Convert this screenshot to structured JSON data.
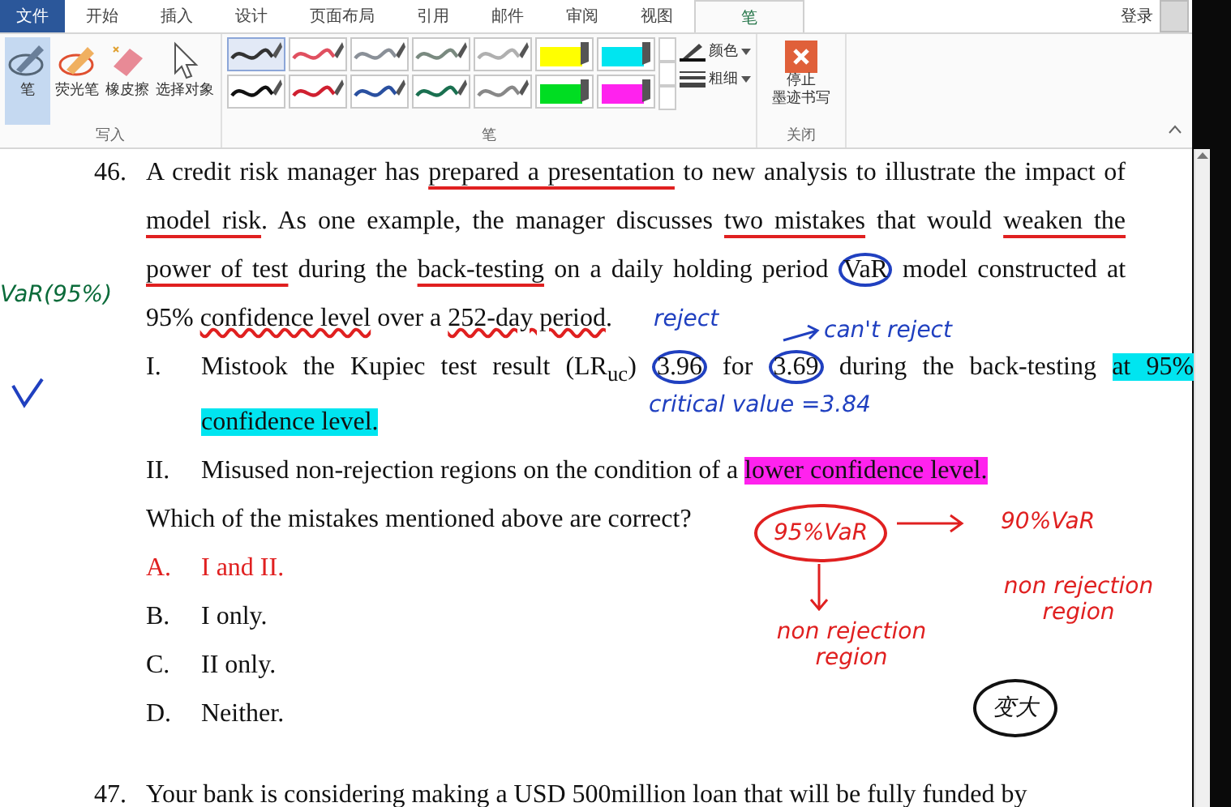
{
  "tabs": [
    {
      "label": "文件",
      "kind": "file",
      "selected": false
    },
    {
      "label": "开始",
      "kind": "tab",
      "selected": false
    },
    {
      "label": "插入",
      "kind": "tab",
      "selected": false
    },
    {
      "label": "设计",
      "kind": "tab",
      "selected": false
    },
    {
      "label": "页面布局",
      "kind": "tab",
      "selected": false
    },
    {
      "label": "引用",
      "kind": "tab",
      "selected": false
    },
    {
      "label": "邮件",
      "kind": "tab",
      "selected": false
    },
    {
      "label": "审阅",
      "kind": "tab",
      "selected": false
    },
    {
      "label": "视图",
      "kind": "tab",
      "selected": false
    },
    {
      "label": "笔",
      "kind": "tab",
      "selected": true
    }
  ],
  "account": {
    "label": "登录"
  },
  "write_group": {
    "label": "写入",
    "tools": [
      {
        "label": "笔",
        "kind": "pen",
        "selected": true
      },
      {
        "label": "荧光笔",
        "kind": "highlighter",
        "selected": false
      },
      {
        "label": "橡皮擦",
        "kind": "eraser",
        "selected": false
      },
      {
        "label": "选择对象",
        "kind": "select",
        "selected": false
      }
    ]
  },
  "pens_group": {
    "label": "笔",
    "pens": [
      {
        "kind": "pen",
        "color": "#333333",
        "selected": true
      },
      {
        "kind": "pen",
        "color": "#e05060",
        "selected": false
      },
      {
        "kind": "pen",
        "color": "#8a9098",
        "selected": false
      },
      {
        "kind": "pen",
        "color": "#7a8a80",
        "selected": false
      },
      {
        "kind": "pen",
        "color": "#b0b0b0",
        "selected": false
      },
      {
        "kind": "highlighter",
        "color": "#ffff00",
        "selected": false
      },
      {
        "kind": "highlighter",
        "color": "#00e5f0",
        "selected": false
      },
      {
        "kind": "pen",
        "color": "#111111",
        "selected": false
      },
      {
        "kind": "pen",
        "color": "#d02030",
        "selected": false
      },
      {
        "kind": "pen",
        "color": "#2a50a0",
        "selected": false
      },
      {
        "kind": "pen",
        "color": "#1a7050",
        "selected": false
      },
      {
        "kind": "pen",
        "color": "#888888",
        "selected": false
      },
      {
        "kind": "highlighter",
        "color": "#00dd22",
        "selected": false
      },
      {
        "kind": "highlighter",
        "color": "#ff22ee",
        "selected": false
      }
    ],
    "options": [
      {
        "label": "颜色",
        "kind": "color"
      },
      {
        "label": "粗细",
        "kind": "thickness"
      }
    ]
  },
  "close_group": {
    "label": "关闭",
    "button_lines": [
      "停止",
      "墨迹书写"
    ]
  },
  "question": {
    "number": "46.",
    "segments": [
      {
        "text": "A credit risk manager has "
      },
      {
        "text": "prepared a presentation",
        "underlined": true
      },
      {
        "text": " to new analysis to illustrate the impact of "
      },
      {
        "text": "model risk",
        "underlined": true
      },
      {
        "text": ". As one example, the manager discusses "
      },
      {
        "text": "two mistakes",
        "underlined": true
      },
      {
        "text": " that would "
      },
      {
        "text": "weaken the power of test",
        "underlined": true
      },
      {
        "text": " during the "
      },
      {
        "text": "back-testing",
        "underlined": true
      },
      {
        "text": " on a daily holding period "
      },
      {
        "text": "VaR",
        "circled": true
      },
      {
        "text": " model constructed at 95% "
      },
      {
        "text": "confidence level",
        "wavy": true
      },
      {
        "text": " over a "
      },
      {
        "text": "252-day period",
        "wavy": true
      },
      {
        "text": "."
      }
    ],
    "statements": [
      {
        "number": "I.",
        "segments": [
          {
            "text": "Mistook the Kupiec test result (LR$_{uc}$) "
          },
          {
            "text": "3.96",
            "circled": true
          },
          {
            "text": " for "
          },
          {
            "text": "3.69",
            "circled": true
          },
          {
            "text": " during the back-testing "
          },
          {
            "text": "at 95% confidence level.",
            "color": "#00e5f0"
          }
        ]
      },
      {
        "number": "II.",
        "segments": [
          {
            "text": "Misused non-rejection regions on the condition of a "
          },
          {
            "text": "lower confidence level.",
            "color": "#ff22ee"
          }
        ]
      }
    ],
    "prompt": "Which of the mistakes mentioned above are correct?",
    "options": [
      {
        "letter": "A.",
        "text": "I and II.",
        "selected": true
      },
      {
        "letter": "B.",
        "text": "I only.",
        "selected": false
      },
      {
        "letter": "C.",
        "text": "II only.",
        "selected": false
      },
      {
        "letter": "D.",
        "text": "Neither.",
        "selected": false
      }
    ]
  },
  "next_question": {
    "number": "47.",
    "text": "Your bank is considering making a USD 500million loan that will be fully funded by"
  },
  "annotations": [
    {
      "text": "VaR(95%)",
      "color": "#0b6b3a"
    },
    {
      "text": "reject",
      "color": "#2040c0"
    },
    {
      "text": "can't reject",
      "color": "#2040c0"
    },
    {
      "text": "critical value =3.84",
      "color": "#2040c0"
    },
    {
      "text": "95%VaR",
      "color": "#e02020"
    },
    {
      "text": "90%VaR",
      "color": "#e02020"
    },
    {
      "text": "non rejection region",
      "color": "#e02020"
    },
    {
      "text": "non rejection region",
      "color": "#e02020"
    },
    {
      "text": "变大",
      "color": "#111111"
    }
  ]
}
